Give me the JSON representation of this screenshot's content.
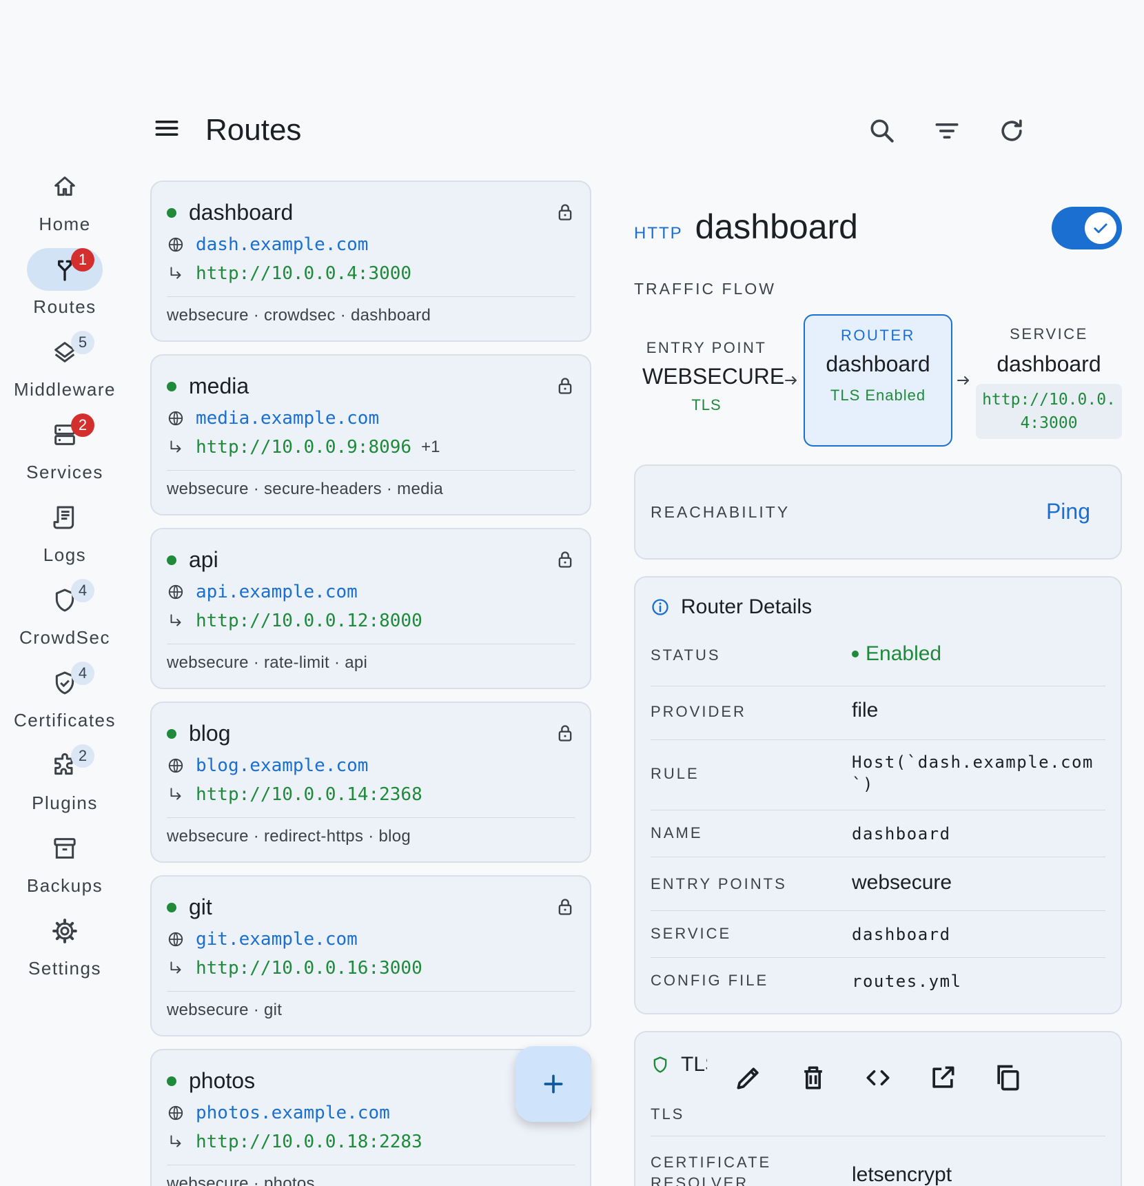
{
  "header": {
    "title": "Routes"
  },
  "nav": [
    {
      "label": "Home",
      "icon": "home-icon",
      "badge": ""
    },
    {
      "label": "Routes",
      "icon": "routes-icon",
      "badge": "1",
      "active": true
    },
    {
      "label": "Middleware",
      "icon": "layers-icon",
      "badge": "5"
    },
    {
      "label": "Services",
      "icon": "server-icon",
      "badge": "2"
    },
    {
      "label": "Logs",
      "icon": "receipt-icon",
      "badge": ""
    },
    {
      "label": "CrowdSec",
      "icon": "shield-icon",
      "badge": "4"
    },
    {
      "label": "Certificates",
      "icon": "shield-check-icon",
      "badge": "4"
    },
    {
      "label": "Plugins",
      "icon": "puzzle-icon",
      "badge": "2"
    },
    {
      "label": "Backups",
      "icon": "archive-icon",
      "badge": ""
    },
    {
      "label": "Settings",
      "icon": "gear-icon",
      "badge": ""
    }
  ],
  "routes": [
    {
      "name": "dashboard",
      "host": "dash.example.com",
      "target": "http://10.0.0.4:3000",
      "extra": "",
      "chain": "websecure · crowdsec · dashboard"
    },
    {
      "name": "media",
      "host": "media.example.com",
      "target": "http://10.0.0.9:8096",
      "extra": "+1",
      "chain": "websecure · secure-headers · media"
    },
    {
      "name": "api",
      "host": "api.example.com",
      "target": "http://10.0.0.12:8000",
      "extra": "",
      "chain": "websecure · rate-limit · api"
    },
    {
      "name": "blog",
      "host": "blog.example.com",
      "target": "http://10.0.0.14:2368",
      "extra": "",
      "chain": "websecure · redirect-https · blog"
    },
    {
      "name": "git",
      "host": "git.example.com",
      "target": "http://10.0.0.16:3000",
      "extra": "",
      "chain": "websecure · git"
    },
    {
      "name": "photos",
      "host": "photos.example.com",
      "target": "http://10.0.0.18:2283",
      "extra": "",
      "chain": "websecure · photos"
    }
  ],
  "detail": {
    "type": "HTTP",
    "title": "dashboard",
    "enabled": true,
    "flow_label": "TRAFFIC FLOW",
    "entry": {
      "caption": "ENTRY POINT",
      "name": "WEBSECURE",
      "sub": "TLS"
    },
    "router": {
      "caption": "ROUTER",
      "name": "dashboard",
      "sub": "TLS Enabled"
    },
    "service": {
      "caption": "SERVICE",
      "name": "dashboard",
      "url": "http://10.0.0.4:3000"
    },
    "reachability": {
      "label": "REACHABILITY",
      "action": "Ping"
    },
    "router_details": {
      "title": "Router Details",
      "rows": [
        {
          "key": "STATUS",
          "value": "Enabled"
        },
        {
          "key": "PROVIDER",
          "value": "file"
        },
        {
          "key": "RULE",
          "value": "Host(`dash.example.com`)"
        },
        {
          "key": "NAME",
          "value": "dashboard"
        },
        {
          "key": "ENTRY POINTS",
          "value": "websecure"
        },
        {
          "key": "SERVICE",
          "value": "dashboard"
        },
        {
          "key": "CONFIG FILE",
          "value": "routes.yml"
        }
      ]
    },
    "tls": {
      "title": "TLS",
      "sub": "TLS",
      "resolver_key": "CERTIFICATE RESOLVER",
      "resolver_value": "letsencrypt"
    }
  },
  "colors": {
    "accent": "#1a6fd0",
    "success": "#1e8a3a",
    "badge": "#d32f2f"
  }
}
